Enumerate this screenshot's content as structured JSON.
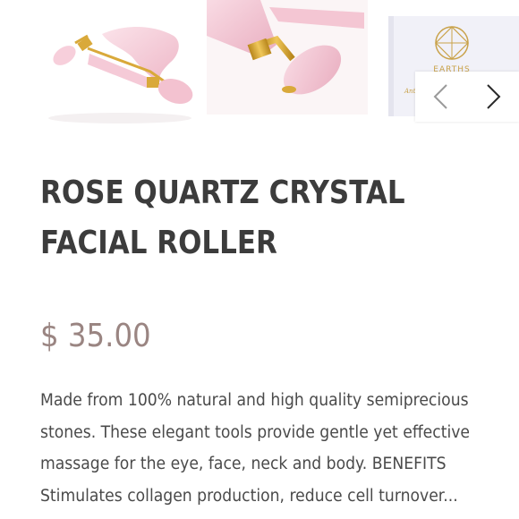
{
  "product": {
    "title": "ROSE QUARTZ CRYSTAL FACIAL ROLLER",
    "price": "$ 35.00",
    "description": "Made from 100% natural and high quality semiprecious stones. These elegant tools provide gentle yet effective massage for the eye, face, neck and body. BENEFITS Stimulates collagen production, reduce cell turnover..."
  },
  "gallery": {
    "thumbnails": [
      {
        "icon": "roller-and-gua-sha-photo"
      },
      {
        "icon": "roller-closeup-photo"
      },
      {
        "icon": "product-box-photo",
        "visible_text": "EARTHS"
      }
    ],
    "prev_icon": "chevron-left-icon",
    "next_icon": "chevron-right-icon"
  },
  "colors": {
    "title": "#3c3c3c",
    "price": "#9a8582",
    "body_text": "#4a4a4a",
    "rose_quartz": "#f2c7d3",
    "gold": "#d9a93a"
  }
}
